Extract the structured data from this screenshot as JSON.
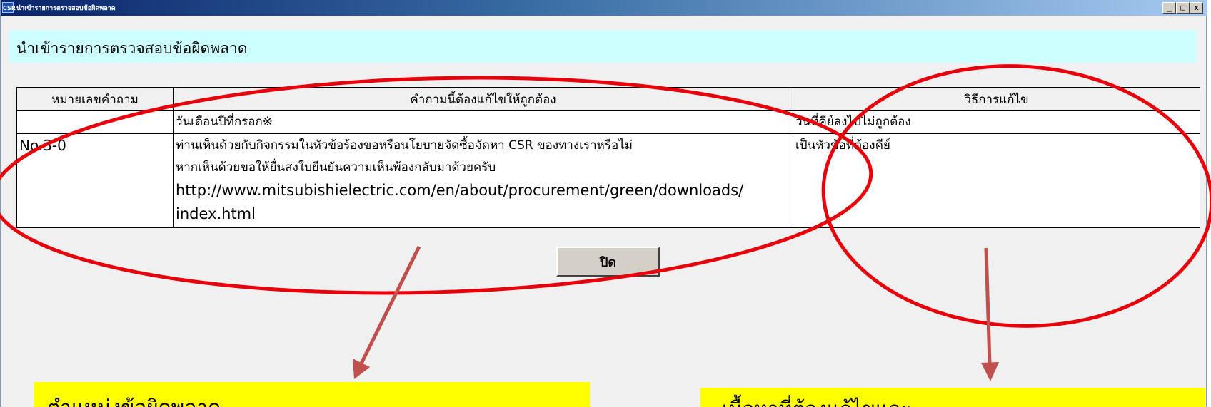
{
  "window": {
    "icon_text": "CSR",
    "title": "นำเข้ารายการตรวจสอบข้อผิดพลาด",
    "controls": {
      "minimize": "_",
      "maximize": "□",
      "close": "x"
    }
  },
  "header": {
    "title": "นำเข้ารายการตรวจสอบข้อผิดพลาด"
  },
  "table": {
    "columns": [
      "หมายเลขคำถาม",
      "คำถามนี้ต้องแก้ไขให้ถูกต้อง",
      "วิธีการแก้ไข"
    ],
    "rows": [
      {
        "number": "",
        "question": "วันเดือนปีที่กรอก※",
        "fix": "วันที่คีย์ลงไปไม่ถูกต้อง"
      },
      {
        "number": "No.3-0",
        "question_line1": "ท่านเห็นด้วยกับกิจกรรมในหัวข้อร้องขอหรือนโยบายจัดซื้อจัดหา CSR ของทางเราหรือไม่",
        "question_line2": "หากเห็นด้วยขอให้ยื่นส่งใบยืนยันความเห็นพ้องกลับมาด้วยครับ",
        "question_url_line1": "http://www.mitsubishielectric.com/en/about/procurement/green/downloads/",
        "question_url_line2": "index.html",
        "fix": "เป็นหัวข้อที่ต้องคีย์"
      }
    ]
  },
  "close_button": {
    "label": "ปิด"
  },
  "annotations": {
    "callout_left": "ตำแหน่งข้อผิดพลาด",
    "callout_right": "เนื้อหาที่ต้องแก้ไขและ",
    "colors": {
      "highlight_ellipse": "#e8000b",
      "arrow": "#c0504d",
      "callout_bg": "#ffff00"
    }
  }
}
